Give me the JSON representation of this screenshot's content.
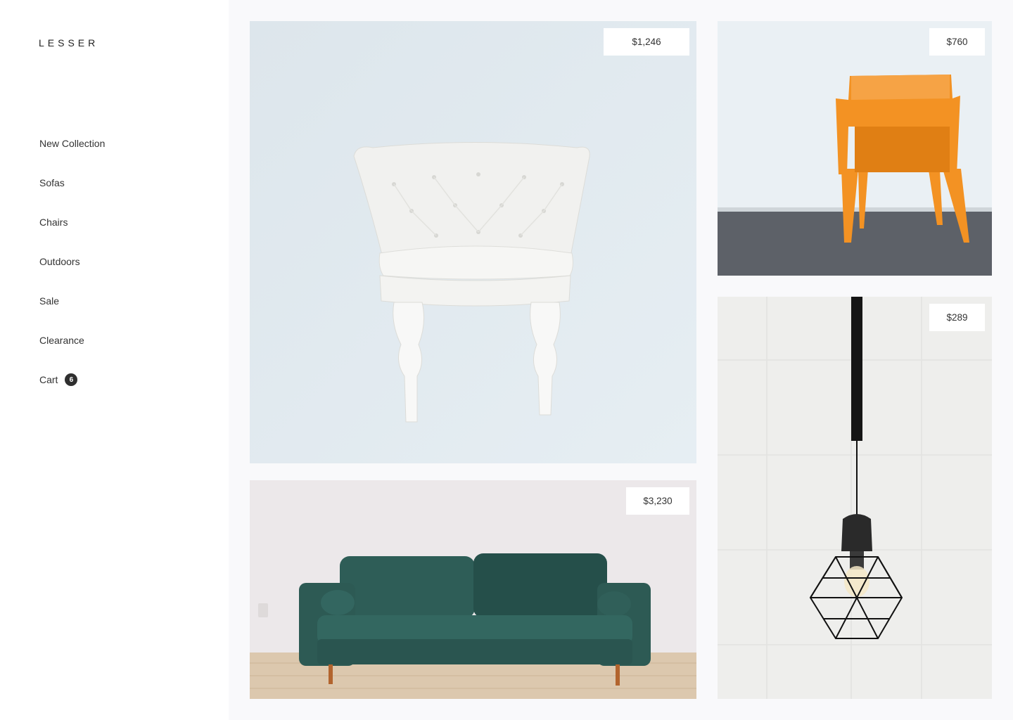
{
  "brand": {
    "logo": "LESSER"
  },
  "nav": {
    "items": [
      {
        "label": "New Collection"
      },
      {
        "label": "Sofas"
      },
      {
        "label": "Chairs"
      },
      {
        "label": "Outdoors"
      },
      {
        "label": "Sale"
      },
      {
        "label": "Clearance"
      }
    ],
    "cart": {
      "label": "Cart",
      "count": "6"
    }
  },
  "products": {
    "armchair": {
      "price": "$1,246",
      "icon": "white-tufted-armchair"
    },
    "orange_chair": {
      "price": "$760",
      "icon": "orange-plastic-chair"
    },
    "sofa": {
      "price": "$3,230",
      "icon": "green-velvet-sofa"
    },
    "lamp": {
      "price": "$289",
      "icon": "geometric-pendant-lamp"
    }
  },
  "colors": {
    "sidebar_bg": "#ffffff",
    "page_bg": "#f9f9fb",
    "badge_bg": "#2f2f2f",
    "chair_orange": "#f39223",
    "sofa_green": "#2e5d57"
  }
}
